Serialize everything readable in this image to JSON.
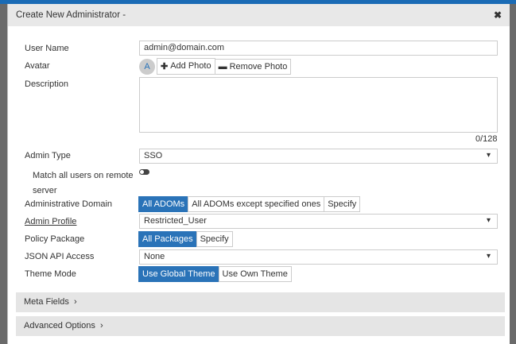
{
  "dialog": {
    "title": "Create New Administrator -",
    "close": "✖"
  },
  "form": {
    "user_name": {
      "label": "User Name",
      "value": "admin@domain.com"
    },
    "avatar": {
      "label": "Avatar",
      "initial": "A",
      "add": "Add Photo",
      "remove": "Remove Photo"
    },
    "description": {
      "label": "Description",
      "value": "",
      "counter": "0/128"
    },
    "admin_type": {
      "label": "Admin Type",
      "value": "SSO"
    },
    "match_all": {
      "label": "Match all users on remote server",
      "enabled": false
    },
    "adom": {
      "label": "Administrative Domain",
      "options": [
        "All ADOMs",
        "All ADOMs except specified ones",
        "Specify"
      ],
      "selected": "All ADOMs"
    },
    "admin_profile": {
      "label": "Admin Profile",
      "value": "Restricted_User"
    },
    "policy_package": {
      "label": "Policy Package",
      "options": [
        "All Packages",
        "Specify"
      ],
      "selected": "All Packages"
    },
    "json_api": {
      "label": "JSON API Access",
      "value": "None"
    },
    "theme_mode": {
      "label": "Theme Mode",
      "options": [
        "Use Global Theme",
        "Use Own Theme"
      ],
      "selected": "Use Global Theme"
    }
  },
  "sections": {
    "meta": "Meta Fields",
    "advanced": "Advanced Options"
  }
}
